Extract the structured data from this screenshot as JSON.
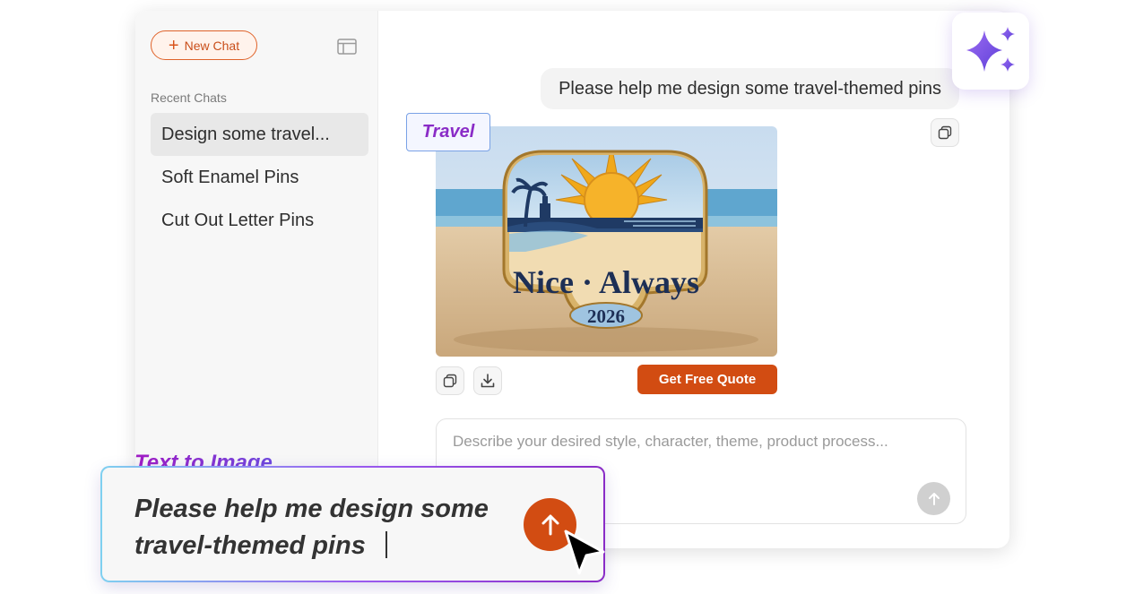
{
  "sidebar": {
    "new_chat_label": "New Chat",
    "recent_label": "Recent Chats",
    "items": [
      {
        "label": "Design some travel..."
      },
      {
        "label": "Soft Enamel Pins"
      },
      {
        "label": "Cut Out Letter Pins"
      }
    ]
  },
  "chat": {
    "user_message": "Please help me design some travel-themed pins",
    "image": {
      "pin_line1": "Nice · Always",
      "pin_year": "2026"
    },
    "quote_button": "Get Free Quote",
    "input_placeholder": "Describe your desired style, character, theme, product process..."
  },
  "overlay": {
    "travel_tag": "Travel",
    "feature_label": "Text to Image",
    "prompt_line1": "Please help me design some",
    "prompt_line2": "travel-themed pins"
  },
  "colors": {
    "accent": "#d24c12",
    "tag_purple": "#8a2cc7",
    "sparkle": "#7a4ee0"
  },
  "icons": {
    "new_chat": "plus-icon",
    "sidebar": "sidebar-toggle-icon",
    "copy": "copy-icon",
    "download": "download-icon",
    "send": "arrow-up-icon",
    "feature": "sparkle-icon",
    "pointer": "cursor-arrow-icon"
  }
}
